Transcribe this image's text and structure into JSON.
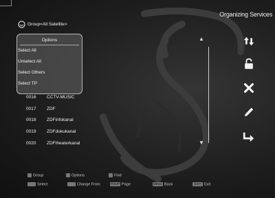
{
  "title": "Organizing Services",
  "group": {
    "label": "Group<All Satellite>",
    "icon": "group-circle-icon"
  },
  "options": {
    "title": "Options",
    "items": [
      {
        "label": "Select All"
      },
      {
        "label": "Unselect All"
      },
      {
        "label": "Select Others"
      },
      {
        "label": "Select TP"
      }
    ]
  },
  "channels": [
    {
      "num": "0016",
      "name": "CCTV-MUSIC"
    },
    {
      "num": "0017",
      "name": "ZDF"
    },
    {
      "num": "0018",
      "name": "ZDFinfokanal"
    },
    {
      "num": "0019",
      "name": "ZDFdokukanal"
    },
    {
      "num": "0020",
      "name": "ZDFtheaterkanal"
    }
  ],
  "side_icons": [
    "sort-arrows-icon",
    "lock-icon",
    "delete-x-icon",
    "pencil-rename-icon",
    "move-arrow-icon"
  ],
  "footer": {
    "group": "Group",
    "options": "Options",
    "find": "Find",
    "select": "Select",
    "change_from": "Change From",
    "page": "Page",
    "back": "Back",
    "exit": "Exit",
    "key_pgup": "PGUP",
    "key_menu": "MENU",
    "key_exit": "EXIT"
  }
}
